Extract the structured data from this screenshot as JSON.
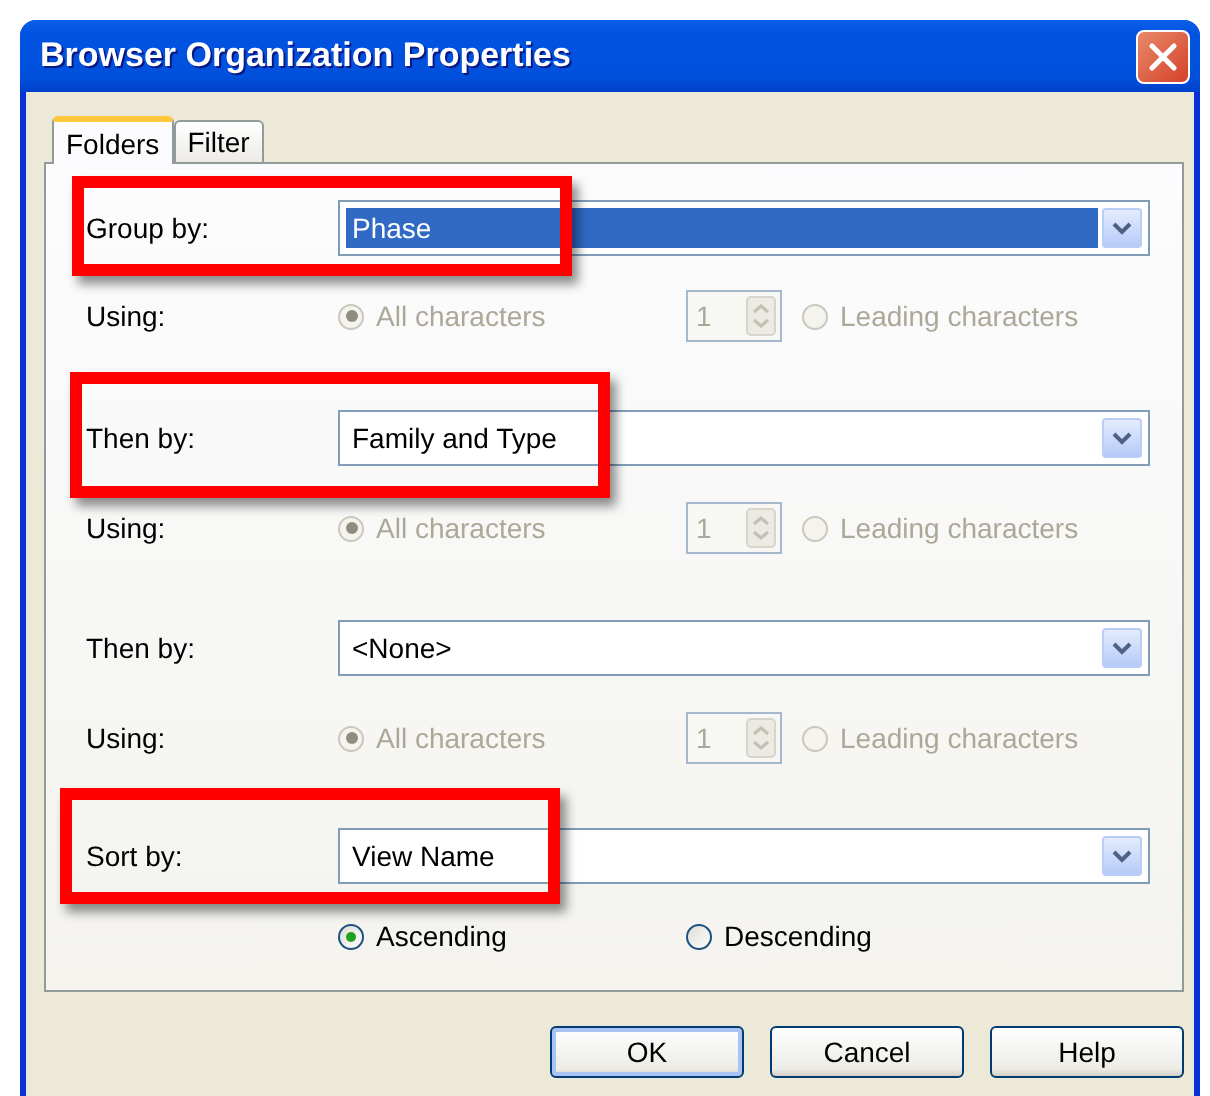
{
  "window": {
    "title": "Browser Organization Properties"
  },
  "tabs": [
    {
      "label": "Folders",
      "selected": true
    },
    {
      "label": "Filter",
      "selected": false
    }
  ],
  "groups": [
    {
      "label": "Group by:",
      "value": "Phase",
      "focused": true,
      "highlighted": true,
      "using": {
        "label": "Using:",
        "disabled": true,
        "count": "1",
        "options": [
          {
            "label": "All characters",
            "selected": true
          },
          {
            "label": "Leading characters",
            "selected": false
          }
        ]
      }
    },
    {
      "label": "Then by:",
      "value": "Family and Type",
      "focused": false,
      "highlighted": true,
      "using": {
        "label": "Using:",
        "disabled": true,
        "count": "1",
        "options": [
          {
            "label": "All characters",
            "selected": true
          },
          {
            "label": "Leading characters",
            "selected": false
          }
        ]
      }
    },
    {
      "label": "Then by:",
      "value": "<None>",
      "focused": false,
      "highlighted": false,
      "using": {
        "label": "Using:",
        "disabled": true,
        "count": "1",
        "options": [
          {
            "label": "All characters",
            "selected": true
          },
          {
            "label": "Leading characters",
            "selected": false
          }
        ]
      }
    }
  ],
  "sort": {
    "label": "Sort by:",
    "value": "View Name",
    "focused": false,
    "highlighted": true,
    "orders": [
      {
        "label": "Ascending",
        "selected": true
      },
      {
        "label": "Descending",
        "selected": false
      }
    ]
  },
  "buttons": [
    {
      "label": "OK",
      "default": true
    },
    {
      "label": "Cancel",
      "default": false
    },
    {
      "label": "Help",
      "default": false
    }
  ]
}
